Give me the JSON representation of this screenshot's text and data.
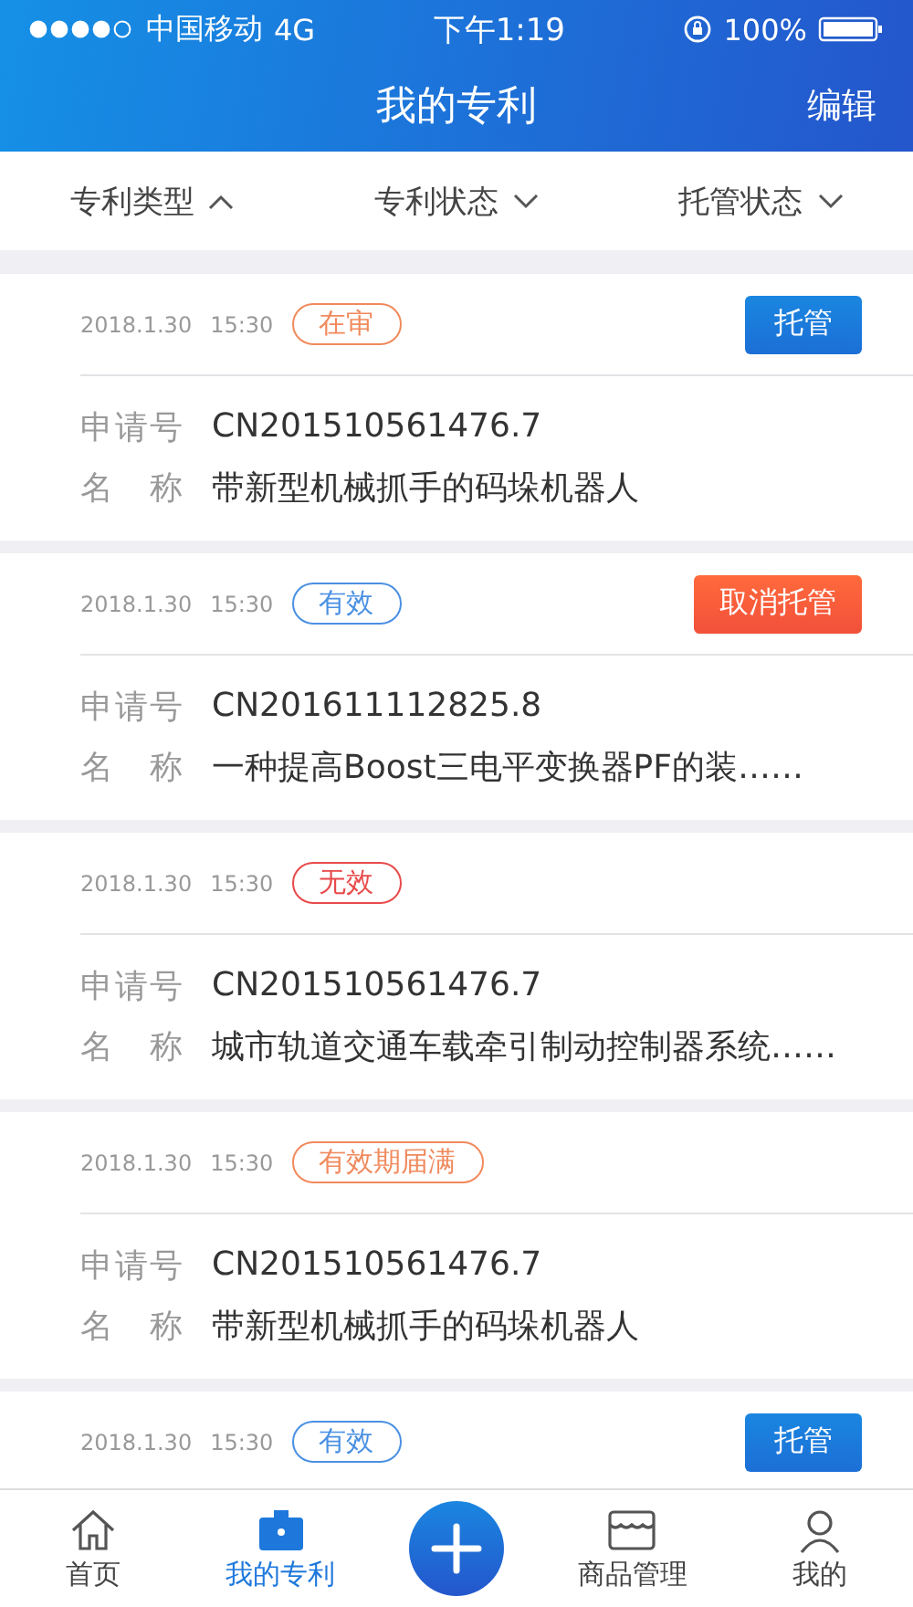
{
  "status_bar": {
    "carrier": "中国移动",
    "network": "4G",
    "time": "下午1:19",
    "battery": "100%"
  },
  "header": {
    "title": "我的专利",
    "action": "编辑"
  },
  "filters": [
    {
      "label": "专利类型",
      "expanded": true
    },
    {
      "label": "专利状态",
      "expanded": false
    },
    {
      "label": "托管状态",
      "expanded": false
    }
  ],
  "patents": [
    {
      "date": "2018.1.30",
      "time": "15:30",
      "status": "在审",
      "color": "#f08a5d",
      "action": {
        "label": "托管",
        "kind": "manage"
      },
      "fields": [
        {
          "label": "申请号",
          "value": "CN201510561476.7"
        },
        {
          "label": "名称",
          "value": "带新型机械抓手的码垛机器人"
        }
      ]
    },
    {
      "date": "2018.1.30",
      "time": "15:30",
      "status": "有效",
      "color": "#4a90e2",
      "action": {
        "label": "取消托管",
        "kind": "cancel"
      },
      "fields": [
        {
          "label": "申请号",
          "value": "CN201611112825.8"
        },
        {
          "label": "名称",
          "value": "一种提高Boost三电平变换器PF的装……"
        }
      ]
    },
    {
      "date": "2018.1.30",
      "time": "15:30",
      "status": "无效",
      "color": "#e84a4a",
      "fields": [
        {
          "label": "申请号",
          "value": "CN201510561476.7"
        },
        {
          "label": "名称",
          "value": "城市轨道交通车载牵引制动控制器系统……"
        }
      ]
    },
    {
      "date": "2018.1.30",
      "time": "15:30",
      "status": "有效期届满",
      "color": "#f08a5d",
      "fields": [
        {
          "label": "申请号",
          "value": "CN201510561476.7"
        },
        {
          "label": "名称",
          "value": "带新型机械抓手的码垛机器人"
        }
      ]
    },
    {
      "date": "2018.1.30",
      "time": "15:30",
      "status": "有效",
      "color": "#4a90e2",
      "action": {
        "label": "托管",
        "kind": "manage"
      }
    }
  ],
  "tab_bar": [
    {
      "kind": "home",
      "label": "首页",
      "selected": false
    },
    {
      "kind": "patent",
      "label": "我的专利",
      "selected": true
    },
    {
      "kind": "add"
    },
    {
      "kind": "goods",
      "label": "商品管理",
      "selected": false
    },
    {
      "kind": "profile",
      "label": "我的",
      "selected": false
    }
  ]
}
